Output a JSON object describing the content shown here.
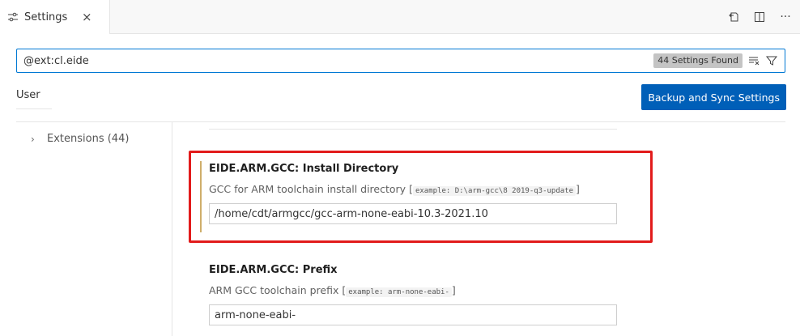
{
  "tab": {
    "title": "Settings",
    "close": "×"
  },
  "actions": {
    "more": "···"
  },
  "search": {
    "value": "@ext:cl.eide",
    "found": "44 Settings Found"
  },
  "scope": {
    "user": "User",
    "sync_button": "Backup and Sync Settings"
  },
  "toc": {
    "chevron": "›",
    "label": "Extensions (44)"
  },
  "settings": [
    {
      "title": "EIDE.ARM.GCC: Install Directory",
      "description": "GCC for ARM toolchain install directory",
      "example": "example: D:\\arm-gcc\\8 2019-q3-update",
      "value": "/home/cdt/armgcc/gcc-arm-none-eabi-10.3-2021.10"
    },
    {
      "title": "EIDE.ARM.GCC: Prefix",
      "description": "ARM GCC toolchain prefix",
      "example": "example: arm-none-eabi-",
      "value": "arm-none-eabi-"
    }
  ],
  "bracket": {
    "open": "[",
    "close": "]"
  },
  "colors": {
    "accent": "#005fb8",
    "search_border": "#0078d4",
    "highlight": "#e21b1b",
    "modified_bar": "#cfae6b"
  },
  "icons": [
    "settings-sliders-icon",
    "close-icon",
    "open-json-icon",
    "split-editor-icon",
    "more-actions-icon",
    "clear-filter-icon",
    "filter-icon",
    "chevron-right-icon"
  ]
}
